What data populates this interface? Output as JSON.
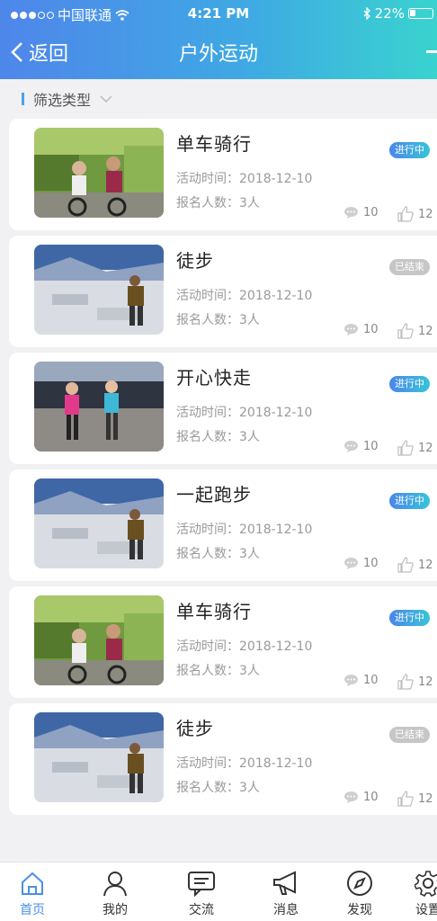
{
  "status_bar": {
    "carrier": "中国联通",
    "time": "4:21 PM",
    "battery": "22%"
  },
  "nav": {
    "back_label": "返回",
    "title": "户外运动"
  },
  "filter": {
    "label": "筛选类型"
  },
  "cards": [
    {
      "title": "单车骑行",
      "time": "活动时间：2018-12-10",
      "count": "报名人数：3人",
      "status": "进行中",
      "status_type": "on",
      "comments": "10",
      "likes": "12",
      "image": "cycling"
    },
    {
      "title": "徒步",
      "time": "活动时间：2018-12-10",
      "count": "报名人数：3人",
      "status": "已结束",
      "status_type": "off",
      "comments": "10",
      "likes": "12",
      "image": "hiking"
    },
    {
      "title": "开心快走",
      "time": "活动时间：2018-12-10",
      "count": "报名人数：3人",
      "status": "进行中",
      "status_type": "on",
      "comments": "10",
      "likes": "12",
      "image": "walking"
    },
    {
      "title": "一起跑步",
      "time": "活动时间：2018-12-10",
      "count": "报名人数：3人",
      "status": "进行中",
      "status_type": "on",
      "comments": "10",
      "likes": "12",
      "image": "hiking"
    },
    {
      "title": "单车骑行",
      "time": "活动时间：2018-12-10",
      "count": "报名人数：3人",
      "status": "进行中",
      "status_type": "on",
      "comments": "10",
      "likes": "12",
      "image": "cycling"
    },
    {
      "title": "徒步",
      "time": "活动时间：2018-12-10",
      "count": "报名人数：3人",
      "status": "已结束",
      "status_type": "off",
      "comments": "10",
      "likes": "12",
      "image": "hiking"
    }
  ],
  "tabbar": [
    {
      "label": "首页",
      "icon": "home-icon",
      "active": true
    },
    {
      "label": "我的",
      "icon": "user-icon",
      "active": false
    },
    {
      "label": "交流",
      "icon": "chat-icon",
      "active": false
    },
    {
      "label": "消息",
      "icon": "megaphone-icon",
      "active": false
    },
    {
      "label": "发现",
      "icon": "compass-icon",
      "active": false
    },
    {
      "label": "设置",
      "icon": "gear-icon",
      "active": false
    }
  ],
  "colors": {
    "header_start": "#4f86ea",
    "header_end": "#39d3cf",
    "active_tab": "#4a90e2",
    "badge_off": "#c6c6c6"
  }
}
